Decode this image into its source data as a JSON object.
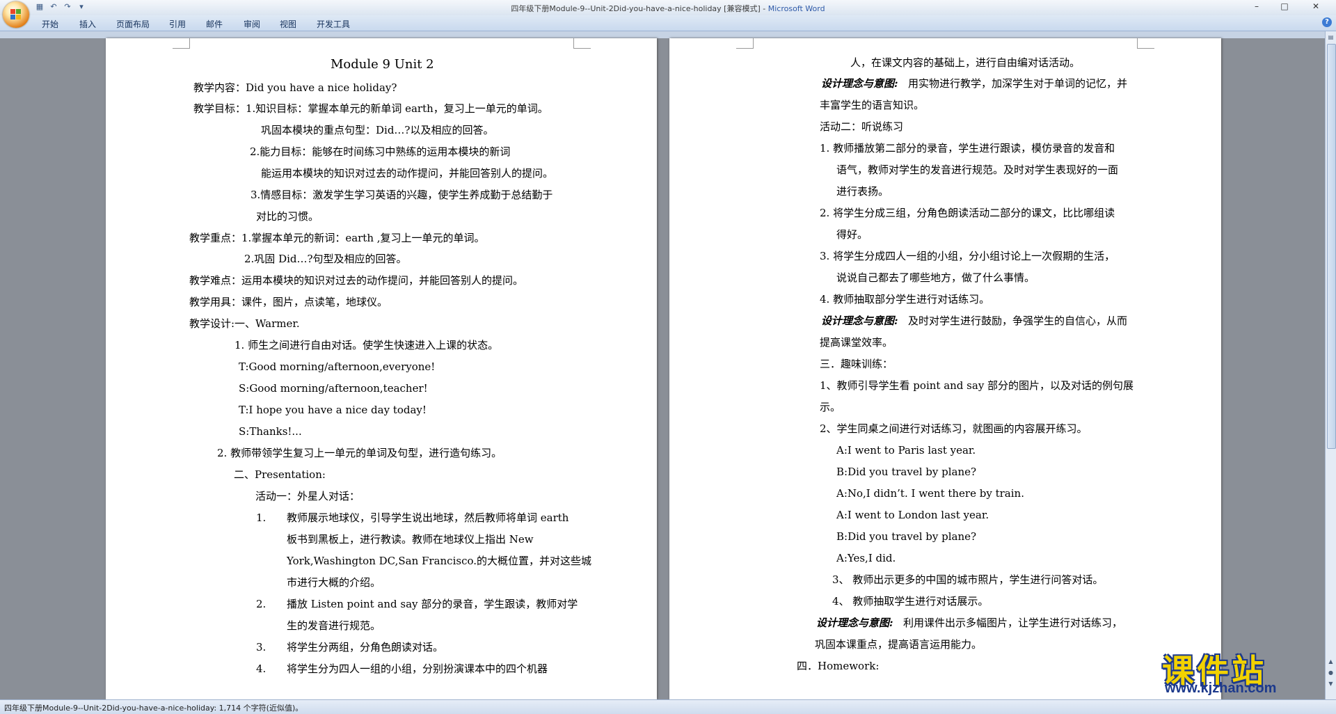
{
  "window": {
    "title_doc": "四年级下册Module-9--Unit-2Did-you-have-a-nice-holiday [兼容模式] - ",
    "title_app": "Microsoft Word"
  },
  "ribbon": {
    "tabs": [
      "开始",
      "插入",
      "页面布局",
      "引用",
      "邮件",
      "审阅",
      "视图",
      "开发工具"
    ]
  },
  "page1": {
    "lines": [
      "Module 9    Unit 2",
      "教学内容：Did    you have a nice holiday?",
      "教学目标：1.知识目标：掌握本单元的新单词 earth，复习上一单元的单词。",
      "巩固本模块的重点句型：Did…?以及相应的回答。",
      "2.能力目标：能够在时间练习中熟练的运用本模块的新词",
      "能运用本模块的知识对过去的动作提问，并能回答别人的提问。",
      "3.情感目标：激发学生学习英语的兴趣，使学生养成勤于总结勤于",
      "对比的习惯。",
      "教学重点：1.掌握本单元的新词：earth ,复习上一单元的单词。",
      "2.巩固 Did…?句型及相应的回答。",
      "教学难点：运用本模块的知识对过去的动作提问，并能回答别人的提问。",
      "教学用具：课件，图片，点读笔，地球仪。",
      "教学设计:一、Warmer.",
      "1.   师生之间进行自由对话。使学生快速进入上课的状态。",
      "T:Good morning/afternoon,everyone!",
      "S:Good morning/afternoon,teacher!",
      "T:I     hope you have a nice day today!",
      "S:Thanks!...",
      "2.        教师带领学生复习上一单元的单词及句型，进行造句练习。",
      "二、Presentation:",
      "活动一：外星人对话：",
      "1.",
      "教师展示地球仪，引导学生说出地球，然后教师将单词 earth",
      "板书到黑板上，进行教读。教师在地球仪上指出  New",
      "York,Washington DC,San Francisco.的大概位置，并对这些城",
      "市进行大概的介绍。",
      "2.",
      "播放 Listen point and say  部分的录音，学生跟读，教师对学",
      "生的发音进行规范。",
      "3.",
      "将学生分两组，分角色朗读对话。",
      "4.",
      "将学生分为四人一组的小组，分别扮演课本中的四个机器"
    ]
  },
  "page2": {
    "lines": [
      "人，在课文内容的基础上，进行自由编对话活动。",
      "设计理念与意图:",
      "用实物进行教学，加深学生对于单词的记忆，并",
      "丰富学生的语言知识。",
      "活动二：听说练习",
      "1.   教师播放第二部分的录音，学生进行跟读，模仿录音的发音和",
      "语气，教师对学生的发音进行规范。及时对学生表现好的一面",
      "进行表扬。",
      "2.   将学生分成三组，分角色朗读活动二部分的课文，比比哪组读",
      "得好。",
      "3.   将学生分成四人一组的小组，分小组讨论上一次假期的生活，",
      "说说自己都去了哪些地方，做了什么事情。",
      "4.   教师抽取部分学生进行对话练习。",
      "设计理念与意图:",
      "及时对学生进行鼓励，争强学生的自信心，从而",
      "提高课堂效率。",
      "三．趣味训练：",
      "1、教师引导学生看 point and say 部分的图片，以及对话的例句展",
      "示。",
      "2、学生同桌之间进行对话练习，就图画的内容展开练习。",
      "A:I     went to Paris last year.",
      "B:Did     you travel by plane?",
      "A:No,I didn’t.    I       went there by train.",
      "A:I      went to London last year.",
      "B:Did you travel by plane?",
      "A:Yes,I did.",
      "3、 教师出示更多的中国的城市照片，学生进行问答对话。",
      "4、 教师抽取学生进行对话展示。",
      "设计理念与意图:",
      "利用课件出示多幅图片，让学生进行对话练习，",
      "巩固本课重点，提高语言运用能力。",
      "四．Homework:"
    ]
  },
  "status": {
    "text": "四年级下册Module-9--Unit-2Did-you-have-a-nice-holiday: 1,714 个字符(近似值)。"
  },
  "watermark": {
    "cn": "课件站",
    "url": "www.kjzhan.com"
  }
}
